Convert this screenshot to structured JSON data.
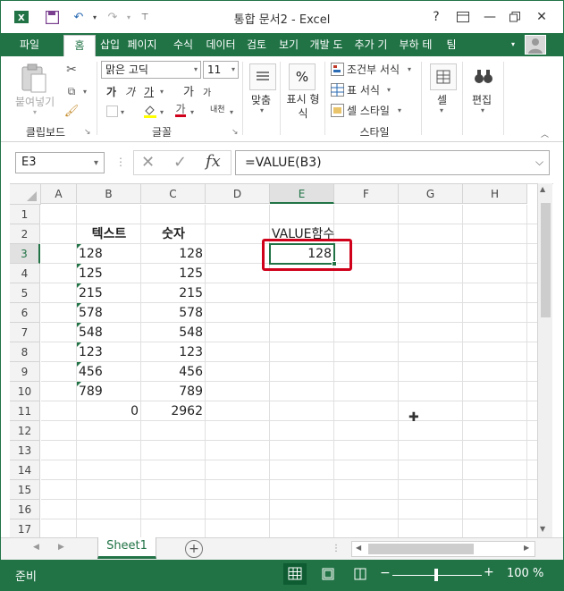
{
  "window": {
    "title": "통합 문서2 - Excel"
  },
  "qat": {
    "app_icon": "excel-icon",
    "save_icon": "save-icon",
    "undo_icon": "undo-icon",
    "redo_icon": "redo-icon"
  },
  "titlebar_buttons": [
    "?",
    "ribbon-display-icon",
    "minimize-icon",
    "restore-icon",
    "close-icon"
  ],
  "tabs": [
    "파일",
    "홈",
    "삽입",
    "페이지",
    "수식",
    "데이터",
    "검토",
    "보기",
    "개발 도",
    "추가 기",
    "부하 테",
    "팀"
  ],
  "ribbon": {
    "clipboard": {
      "paste": "붙여넣기",
      "label": "클립보드"
    },
    "font": {
      "name": "맑은 고딕",
      "size": "11",
      "label": "글꼴",
      "bold": "가",
      "italic": "가",
      "underline": "가",
      "grow": "가",
      "shrink": "가",
      "phonetic": "내천"
    },
    "alignment": {
      "label": "맞춤"
    },
    "number": {
      "label": "표시 형식",
      "glyph": "%"
    },
    "styles": {
      "conditional": "조건부 서식",
      "table": "표 서식",
      "cell_styles": "셀 스타일",
      "label": "스타일"
    },
    "cells": {
      "label": "셀"
    },
    "editing": {
      "label": "편집"
    }
  },
  "formula_bar": {
    "name_box": "E3",
    "formula": "=VALUE(B3)",
    "fx": "fx"
  },
  "columns": [
    "A",
    "B",
    "C",
    "D",
    "E",
    "F",
    "G",
    "H"
  ],
  "rows": [
    "1",
    "2",
    "3",
    "4",
    "5",
    "6",
    "7",
    "8",
    "9",
    "10",
    "11",
    "12",
    "13",
    "14",
    "15",
    "16",
    "17"
  ],
  "cells": {
    "B2": "텍스트",
    "C2": "숫자",
    "E2": "VALUE함수",
    "B3": "128",
    "C3": "128",
    "E3": "128",
    "B4": "125",
    "C4": "125",
    "B5": "215",
    "C5": "215",
    "B6": "578",
    "C6": "578",
    "B7": "548",
    "C7": "548",
    "B8": "123",
    "C8": "123",
    "B9": "456",
    "C9": "456",
    "B10": "789",
    "C10": "789",
    "B11": "0",
    "C11": "2962"
  },
  "sheets": [
    "Sheet1"
  ],
  "status": {
    "mode": "준비",
    "zoom": "100 %"
  },
  "colors": {
    "accent": "#217346",
    "highlight_box": "#d0021b"
  }
}
